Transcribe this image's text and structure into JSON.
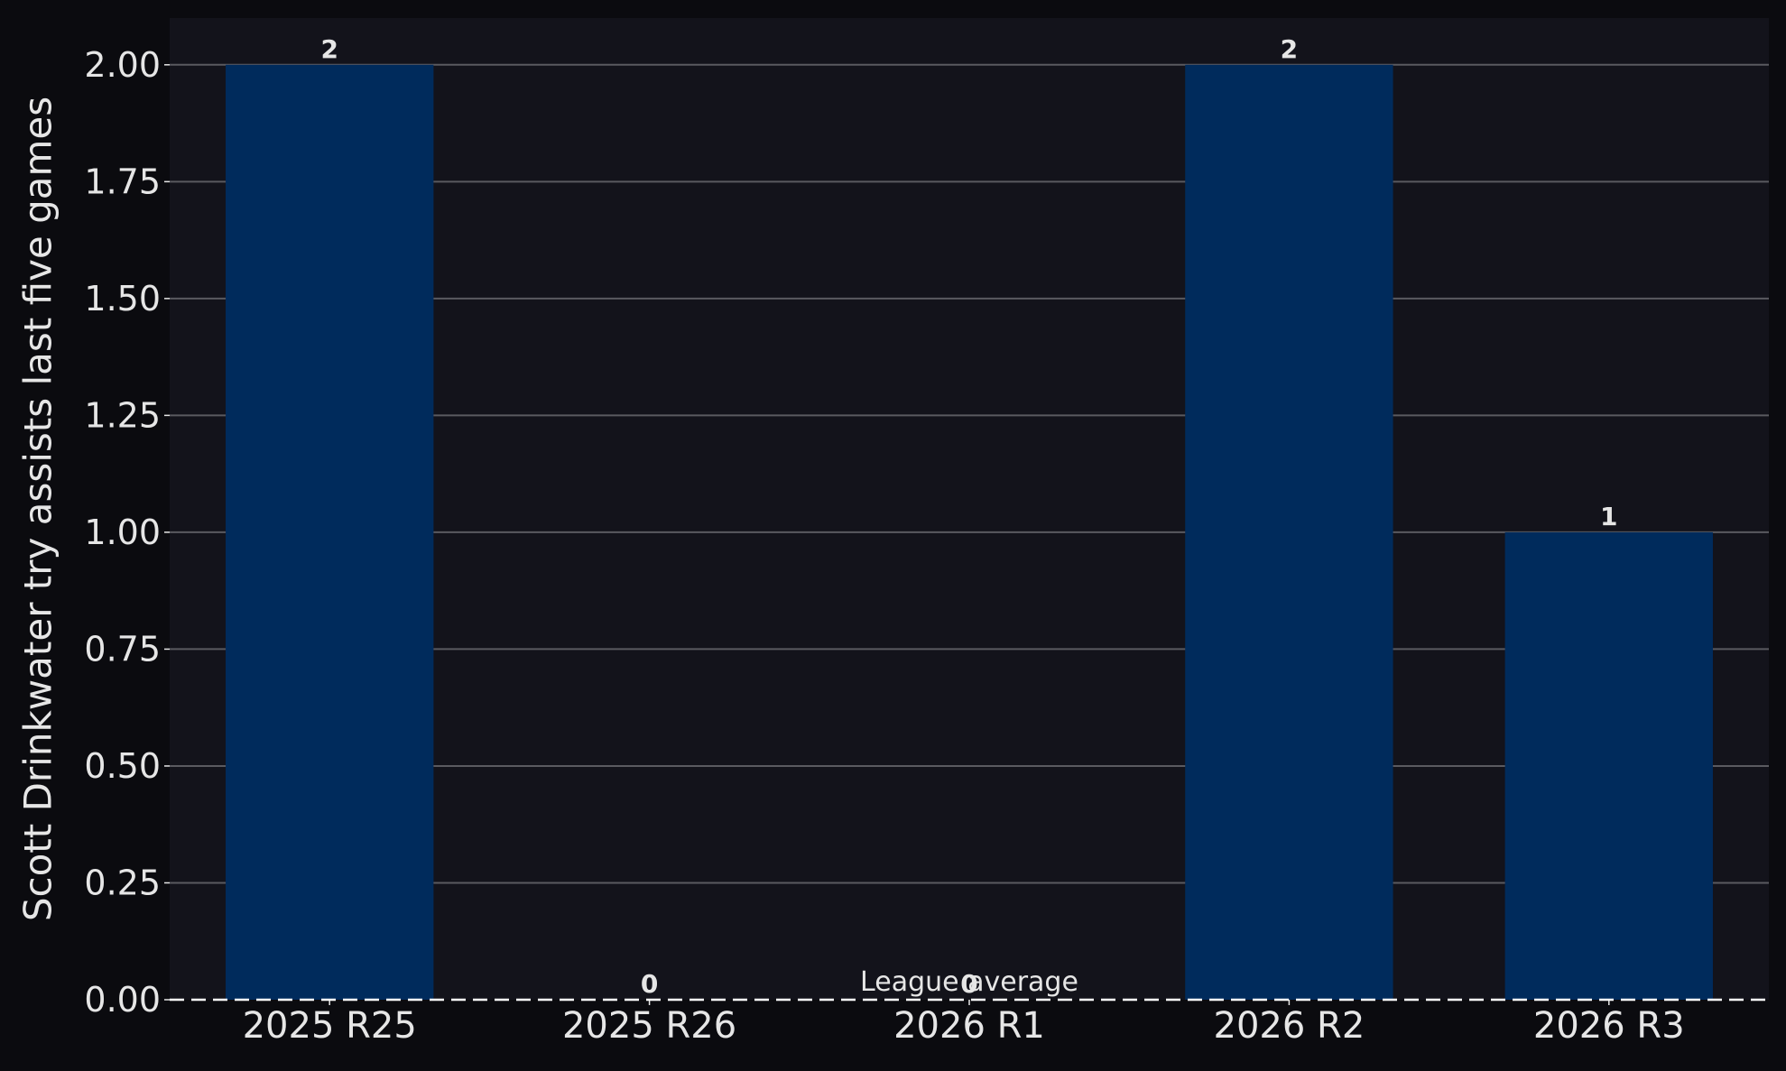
{
  "chart_data": {
    "type": "bar",
    "categories": [
      "2025 R25",
      "2025 R26",
      "2026 R1",
      "2026 R2",
      "2026 R3"
    ],
    "values": [
      2,
      0,
      0,
      2,
      1
    ],
    "data_labels": [
      "2",
      "0",
      "0",
      "2",
      "1"
    ],
    "ylabel": "Scott Drinkwater try assists last five games",
    "xlabel": "",
    "ylim": [
      0,
      2.1
    ],
    "yticks": [
      0,
      0.25,
      0.5,
      0.75,
      1.0,
      1.25,
      1.5,
      1.75,
      2.0
    ],
    "ytick_labels": [
      "0.00",
      "0.25",
      "0.50",
      "0.75",
      "1.00",
      "1.25",
      "1.50",
      "1.75",
      "2.00"
    ],
    "grid": "horizontal",
    "reference_line": {
      "value": 0,
      "label": "League average",
      "style": "dashed"
    },
    "colors": {
      "page_bg": "#0b0b0f",
      "plot_bg": "#13131b",
      "bar": "#002b5c",
      "grid": "#5a5a60",
      "text": "#e6e6e6",
      "reference_line": "#ffffff"
    }
  }
}
